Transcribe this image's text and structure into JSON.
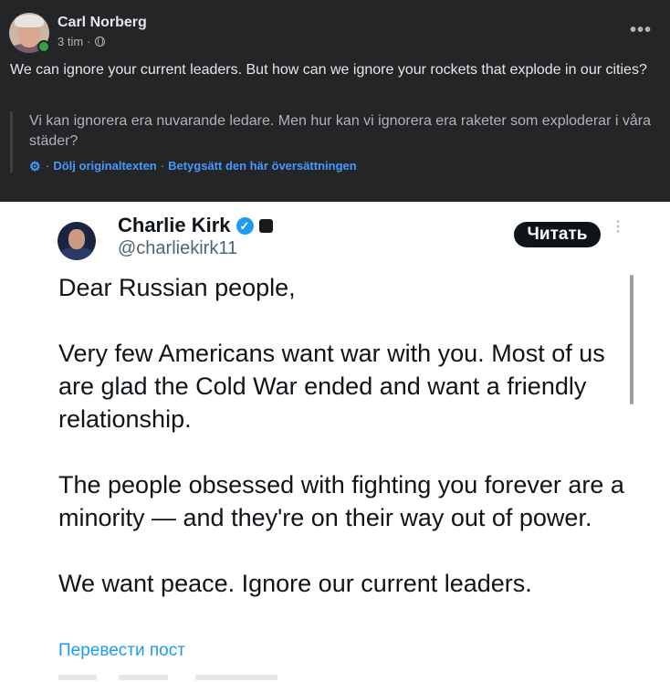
{
  "post": {
    "author": "Carl Norberg",
    "time": "3 tim",
    "time_sep": "·",
    "audience_icon": "globe-icon",
    "more_icon": "more-options-icon",
    "text": "We can ignore your current leaders. But how can we ignore your rockets that explode in our cities?",
    "original_text": "Vi kan ignorera era nuvarande ledare. Men hur kan vi ignorera era raketer som exploderar i våra städer?",
    "hide_original_label": "Dölj originaltexten",
    "rate_translation_label": "Betygsätt den här översättningen",
    "separator": "·"
  },
  "tweet": {
    "name": "Charlie Kirk",
    "handle": "@charliekirk11",
    "follow_label": "Читать",
    "paragraphs": [
      "Dear Russian people,",
      "Very few Americans want war with you. Most of us are glad the Cold War ended and want a friendly relationship.",
      "The people obsessed with fighting you forever are a minority — and they're on their way out of power.",
      "We want peace. Ignore our current leaders."
    ],
    "translate_label": "Перевести пост"
  },
  "colors": {
    "post_bg": "#242526",
    "link_blue": "#4599ff",
    "twitter_blue": "#1d9bf0",
    "online_green": "#31a24c"
  }
}
